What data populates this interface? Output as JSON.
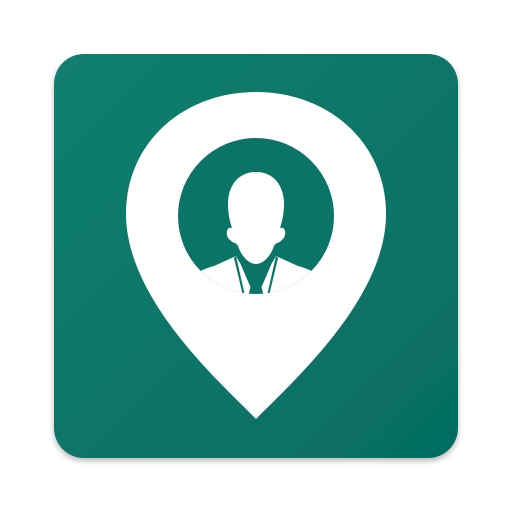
{
  "icon": {
    "name": "location-pin-person-icon",
    "tile_color_top": "#127F6E",
    "tile_color_bottom": "#056D60",
    "pin_color": "#FFFFFF",
    "inner_circle_color": "#0A7566",
    "person_color": "#FFFFFF",
    "tie_color": "#0A7566"
  }
}
